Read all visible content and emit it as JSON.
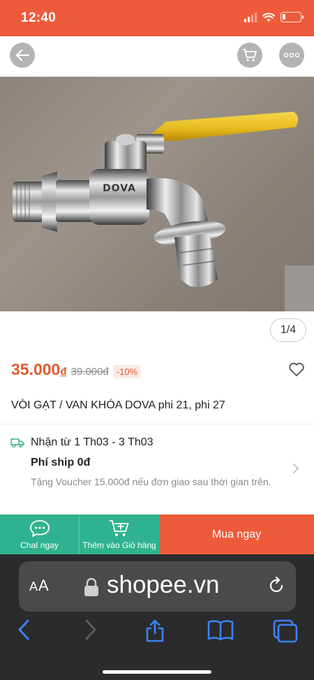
{
  "status_bar": {
    "time": "12:40"
  },
  "product": {
    "image_counter": "1/4",
    "image_brand_text": "DOVA",
    "price_current": "35.000",
    "currency": "đ",
    "price_old": "39.000đ",
    "discount": "-10%",
    "title": "VÒI GẠT / VAN KHÓA DOVA phi 21, phi 27"
  },
  "shipping": {
    "date_text": "Nhận từ 1 Th03 - 3 Th03",
    "fee_text": "Phí ship 0đ",
    "voucher_text": "Tặng Voucher 15.000đ nếu đơn giao sau thời gian trên."
  },
  "actions": {
    "chat_label": "Chat ngay",
    "add_cart_label": "Thêm vào Giỏ hàng",
    "buy_label": "Mua ngay"
  },
  "browser": {
    "aa_small": "A",
    "aa_big": "A",
    "url": "shopee.vn"
  },
  "colors": {
    "brand_orange": "#ee5b3a",
    "price_orange": "#e05a2c",
    "action_green": "#2fb38e",
    "safari_bg": "#2b2b2d"
  },
  "icons": [
    "back-arrow-icon",
    "cart-icon",
    "more-icon",
    "heart-icon",
    "truck-icon",
    "chevron-right-icon",
    "chat-icon",
    "add-to-cart-icon",
    "lock-icon",
    "reload-icon",
    "browser-back-icon",
    "browser-forward-icon",
    "share-icon",
    "bookmarks-icon",
    "tabs-icon"
  ]
}
